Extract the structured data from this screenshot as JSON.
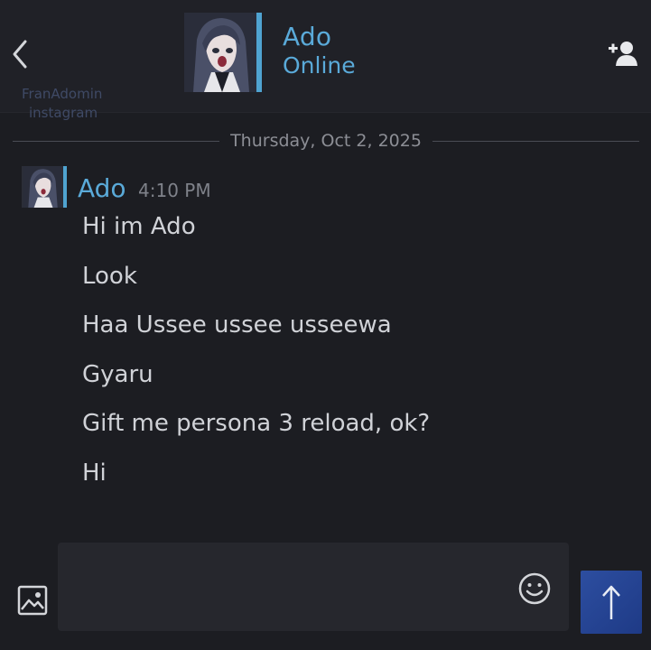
{
  "header": {
    "contact_name": "Ado",
    "status": "Online",
    "back_icon": "chevron-left-icon",
    "add_friend_icon": "add-friend-icon",
    "accent": "#5aaad9"
  },
  "watermark": {
    "line1": "FranAdomin",
    "line2": "instagram"
  },
  "conversation": {
    "date": "Thursday, Oct 2, 2025",
    "sender": "Ado",
    "time": "4:10 PM",
    "messages": [
      "Hi im Ado",
      "Look",
      "Haa Ussee ussee usseewa",
      "Gyaru",
      "Gift me persona 3 reload, ok?",
      "Hi"
    ]
  },
  "composer": {
    "input_value": "",
    "image_icon": "image-icon",
    "emoji_icon": "smiley-icon",
    "send_icon": "arrow-up-icon",
    "send_color": "#2d4ea0"
  }
}
